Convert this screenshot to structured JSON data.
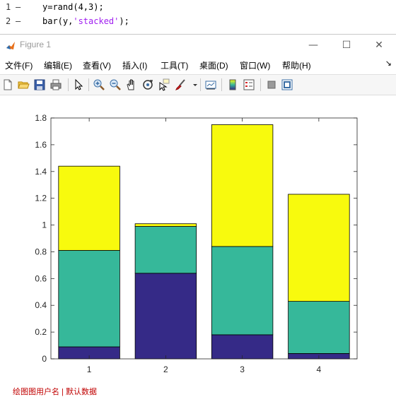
{
  "editor": {
    "lines": [
      {
        "number": "1",
        "marker": "–",
        "code_prefix": "y=rand(4,3);",
        "code_string": "",
        "code_suffix": ""
      },
      {
        "number": "2",
        "marker": "–",
        "code_prefix": "bar(y,",
        "code_string": "'stacked'",
        "code_suffix": ");"
      }
    ]
  },
  "window": {
    "title": "Figure 1",
    "buttons": {
      "minimize": "—",
      "maximize": "☐",
      "close": "✕"
    }
  },
  "menubar": {
    "items": [
      "文件(F)",
      "编辑(E)",
      "查看(V)",
      "插入(I)",
      "工具(T)",
      "桌面(D)",
      "窗口(W)",
      "帮助(H)"
    ],
    "overflow": "↘"
  },
  "toolbar": {
    "icons": [
      "new-figure-icon",
      "open-file-icon",
      "save-icon",
      "print-icon",
      "select-arrow-icon",
      "zoom-in-icon",
      "zoom-out-icon",
      "pan-hand-icon",
      "rotate-3d-icon",
      "data-cursor-icon",
      "brush-icon",
      "brush-dropdown-icon",
      "link-plot-icon",
      "colorbar-icon",
      "legend-icon",
      "hide-plot-tools-icon",
      "show-plot-tools-icon"
    ]
  },
  "bottom_text": "绘图图用户名 | 默认数据",
  "chart_data": {
    "type": "bar",
    "stacked": true,
    "categories": [
      "1",
      "2",
      "3",
      "4"
    ],
    "series": [
      {
        "values": [
          0.09,
          0.64,
          0.18,
          0.04
        ],
        "color": "#352a87"
      },
      {
        "values": [
          0.72,
          0.35,
          0.66,
          0.39
        ],
        "color": "#36b89a"
      },
      {
        "values": [
          0.63,
          0.02,
          0.91,
          0.8
        ],
        "color": "#f8fa0d"
      }
    ],
    "ylim": [
      0,
      1.8
    ],
    "yticks": [
      0,
      0.2,
      0.4,
      0.6,
      0.8,
      1,
      1.2,
      1.4,
      1.6,
      1.8
    ],
    "ytick_labels": [
      "0",
      "0.2",
      "0.4",
      "0.6",
      "0.8",
      "1",
      "1.2",
      "1.4",
      "1.6",
      "1.8"
    ],
    "grid": false,
    "title": "",
    "xlabel": "",
    "ylabel": ""
  }
}
